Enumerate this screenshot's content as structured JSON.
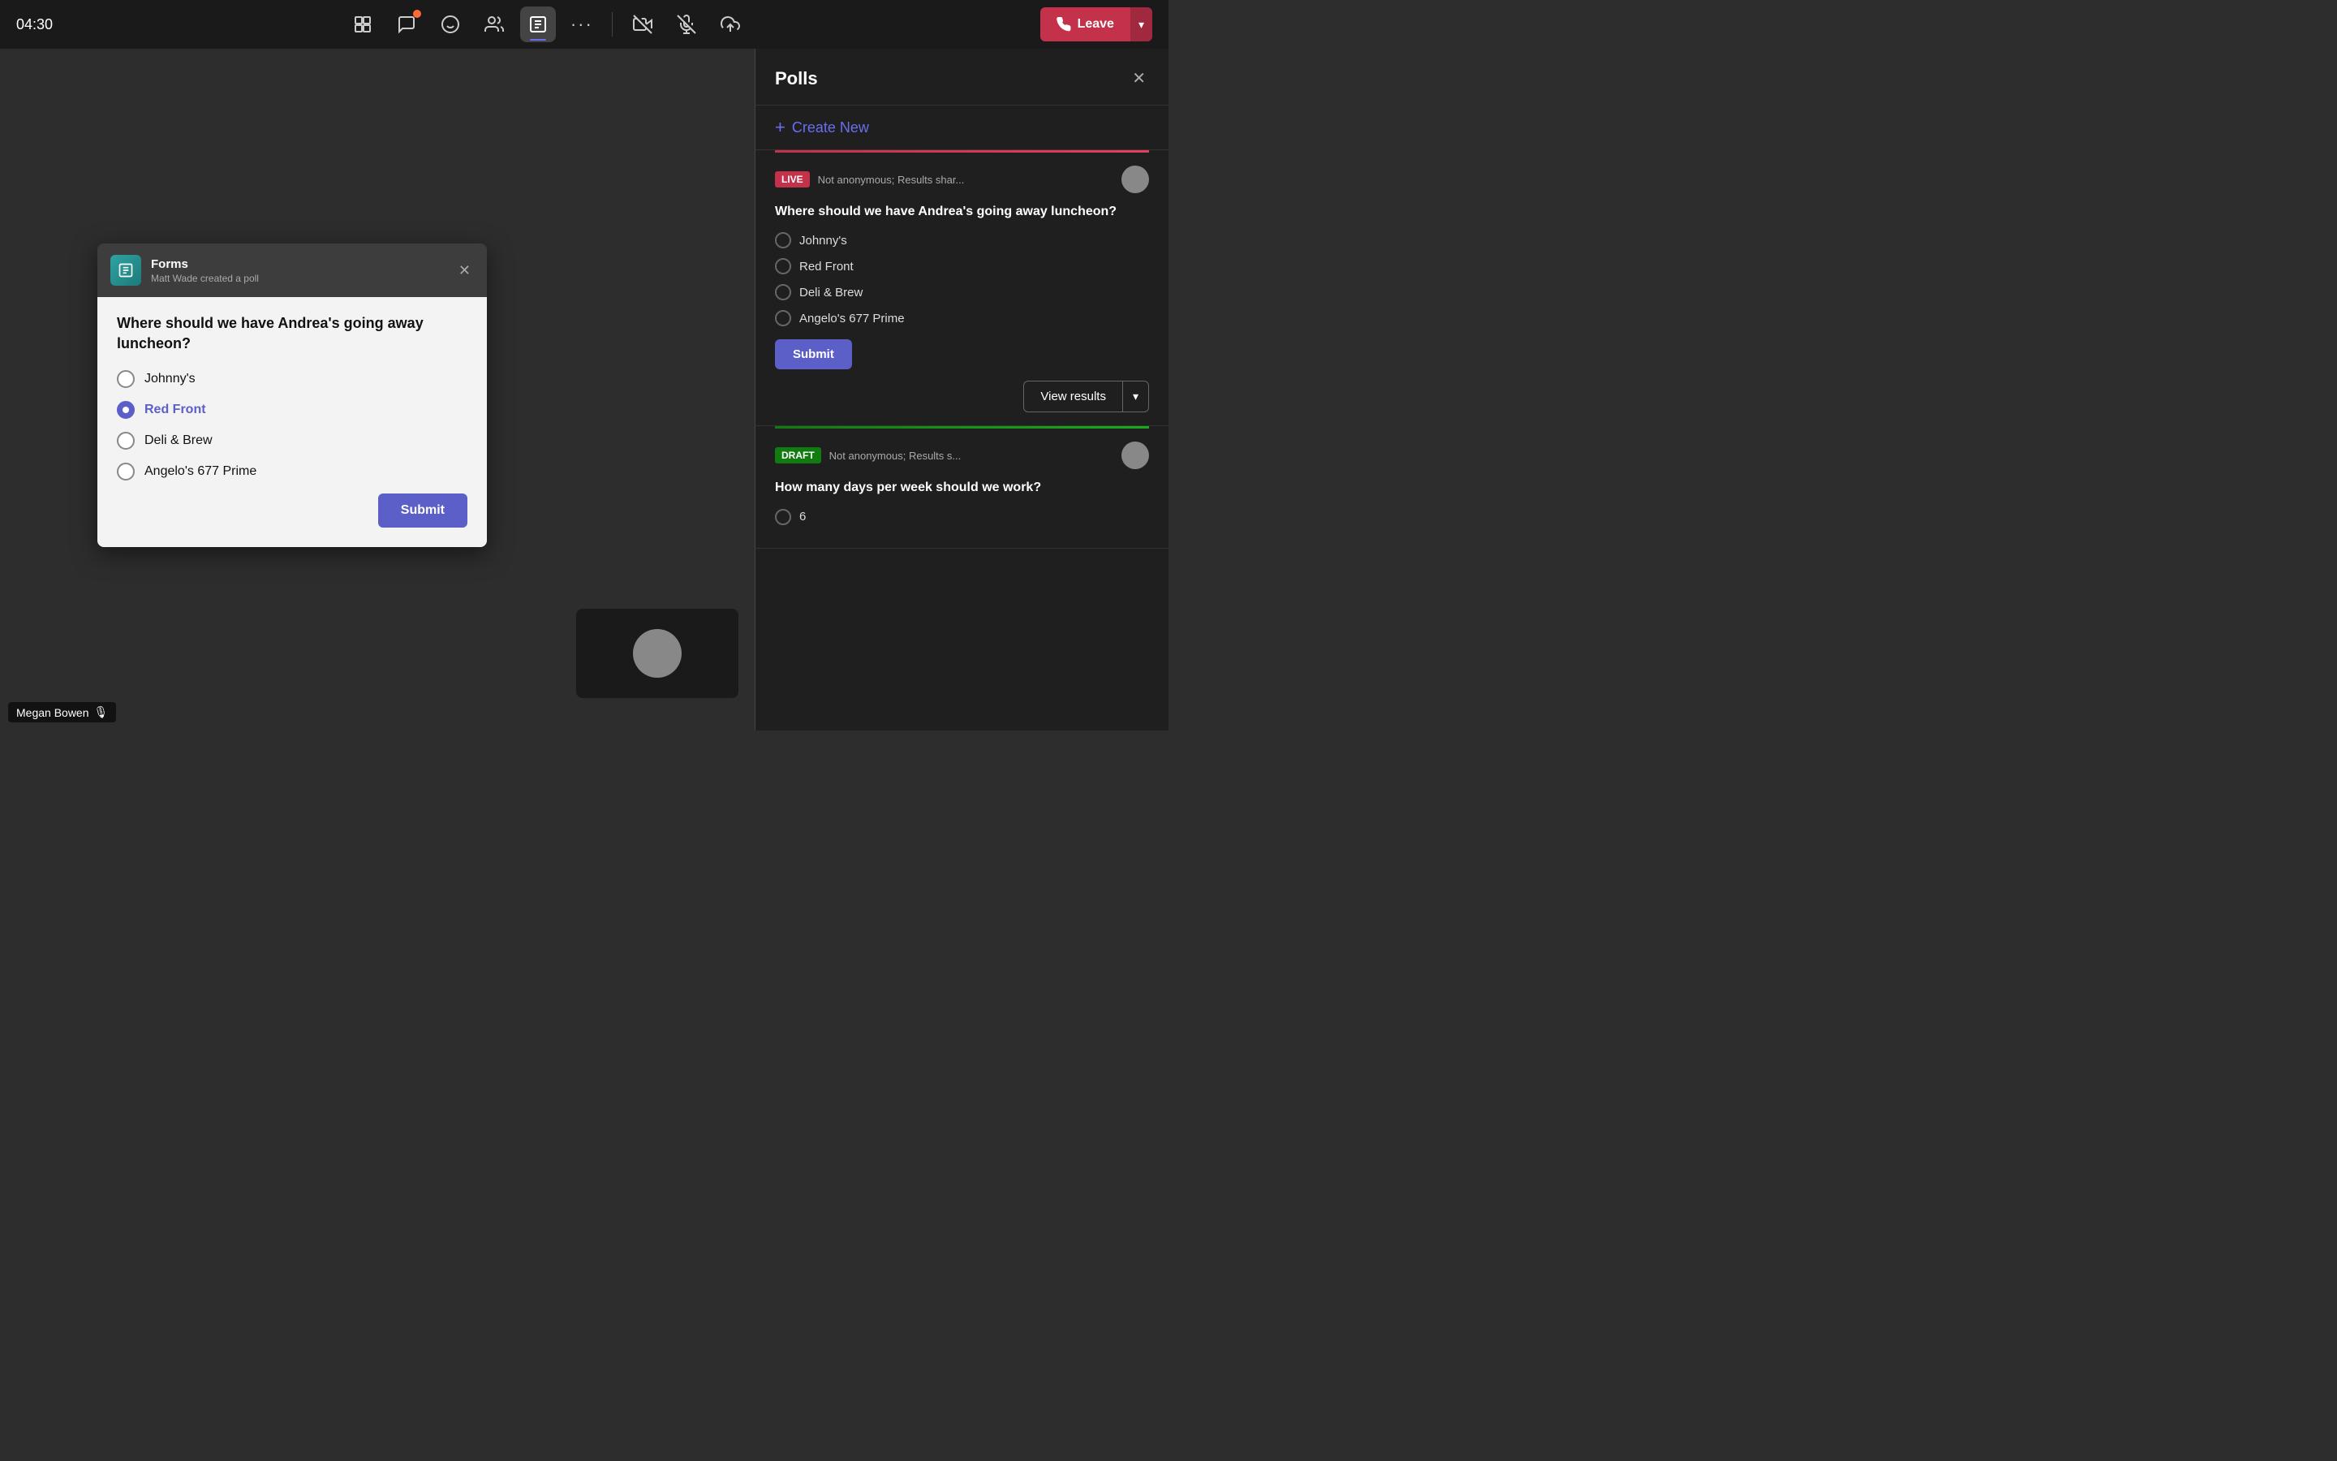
{
  "topbar": {
    "timer": "04:30",
    "icons": [
      {
        "name": "participants-icon",
        "symbol": "⊞",
        "active": false,
        "badge": false
      },
      {
        "name": "chat-icon",
        "symbol": "💬",
        "active": false,
        "badge": true
      },
      {
        "name": "reactions-icon",
        "symbol": "☺",
        "active": false,
        "badge": false
      },
      {
        "name": "people-icon",
        "symbol": "👥",
        "active": false,
        "badge": false
      },
      {
        "name": "forms-icon",
        "symbol": "📋",
        "active": true,
        "badge": false
      },
      {
        "name": "more-icon",
        "symbol": "•••",
        "active": false,
        "badge": false
      }
    ],
    "separator": true,
    "right_icons": [
      {
        "name": "camera-off-icon",
        "symbol": "📵"
      },
      {
        "name": "mic-off-icon",
        "symbol": "🎙"
      },
      {
        "name": "share-icon",
        "symbol": "⬆"
      }
    ],
    "leave_button": "Leave"
  },
  "poll_popup": {
    "app_name": "Forms",
    "subtitle": "Matt Wade created a poll",
    "question": "Where should we have Andrea's going away luncheon?",
    "options": [
      {
        "label": "Johnny's",
        "selected": false
      },
      {
        "label": "Red Front",
        "selected": true
      },
      {
        "label": "Deli & Brew",
        "selected": false
      },
      {
        "label": "Angelo's 677 Prime",
        "selected": false
      }
    ],
    "submit_label": "Submit"
  },
  "right_panel": {
    "title": "Polls",
    "create_new_label": "Create New",
    "live_poll": {
      "badge": "LIVE",
      "meta": "Not anonymous; Results shar...",
      "question": "Where should we have Andrea's going away luncheon?",
      "options": [
        {
          "label": "Johnny's"
        },
        {
          "label": "Red Front"
        },
        {
          "label": "Deli & Brew"
        },
        {
          "label": "Angelo's 677 Prime"
        }
      ],
      "submit_label": "Submit",
      "view_results_label": "View results"
    },
    "draft_poll": {
      "badge": "DRAFT",
      "meta": "Not anonymous; Results s...",
      "question": "How many days per week should we work?",
      "option_num": "6"
    }
  },
  "user": {
    "name": "Megan Bowen",
    "mic_muted": true
  }
}
